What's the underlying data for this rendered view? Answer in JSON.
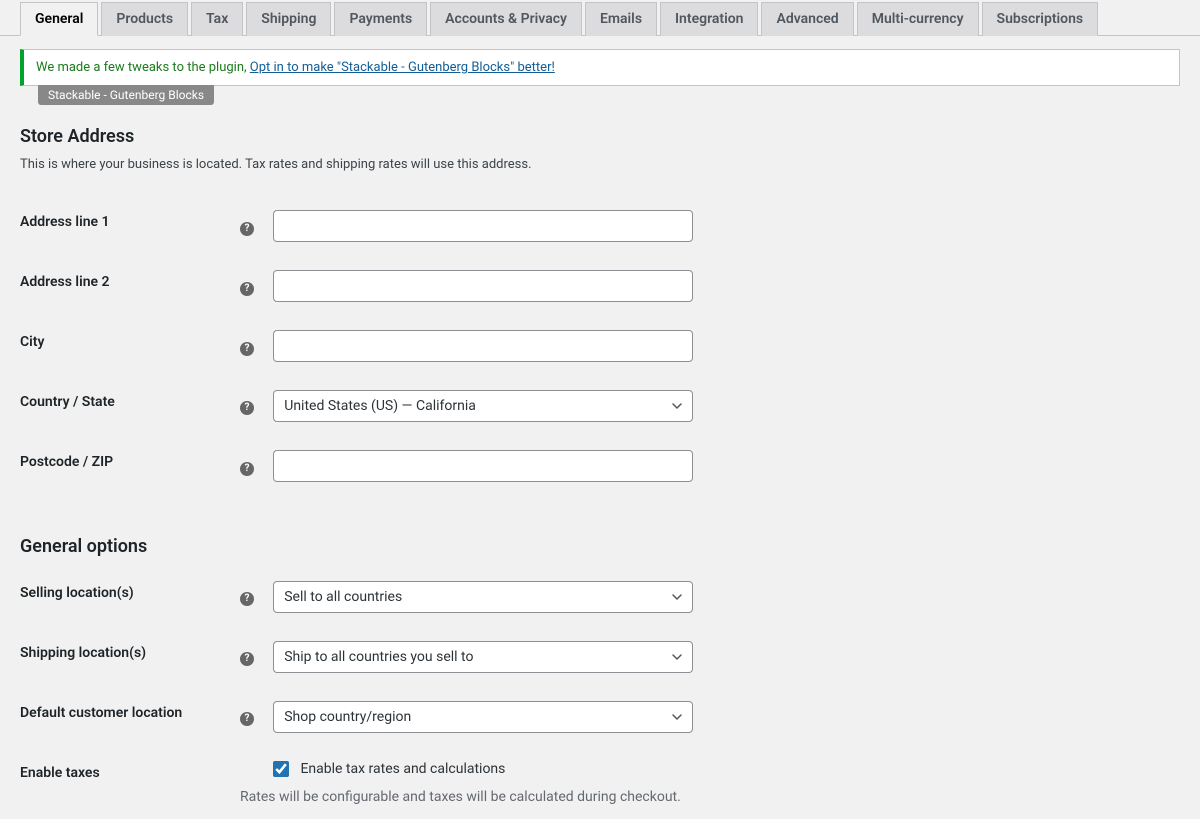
{
  "tabs": [
    {
      "label": "General"
    },
    {
      "label": "Products"
    },
    {
      "label": "Tax"
    },
    {
      "label": "Shipping"
    },
    {
      "label": "Payments"
    },
    {
      "label": "Accounts & Privacy"
    },
    {
      "label": "Emails"
    },
    {
      "label": "Integration"
    },
    {
      "label": "Advanced"
    },
    {
      "label": "Multi-currency"
    },
    {
      "label": "Subscriptions"
    }
  ],
  "notice": {
    "text": "We made a few tweaks to the plugin, ",
    "link": "Opt in to make \"Stackable - Gutenberg Blocks\" better!",
    "badge": "Stackable - Gutenberg Blocks"
  },
  "store_address": {
    "heading": "Store Address",
    "description": "This is where your business is located. Tax rates and shipping rates will use this address.",
    "fields": {
      "address1": {
        "label": "Address line 1",
        "value": ""
      },
      "address2": {
        "label": "Address line 2",
        "value": ""
      },
      "city": {
        "label": "City",
        "value": ""
      },
      "country": {
        "label": "Country / State",
        "value": "United States (US) — California"
      },
      "postcode": {
        "label": "Postcode / ZIP",
        "value": ""
      }
    }
  },
  "general_options": {
    "heading": "General options",
    "fields": {
      "selling": {
        "label": "Selling location(s)",
        "value": "Sell to all countries"
      },
      "shipping": {
        "label": "Shipping location(s)",
        "value": "Ship to all countries you sell to"
      },
      "default_loc": {
        "label": "Default customer location",
        "value": "Shop country/region"
      },
      "enable_taxes": {
        "label": "Enable taxes",
        "checkbox_label": "Enable tax rates and calculations",
        "description": "Rates will be configurable and taxes will be calculated during checkout."
      }
    }
  },
  "help_tip": "?"
}
